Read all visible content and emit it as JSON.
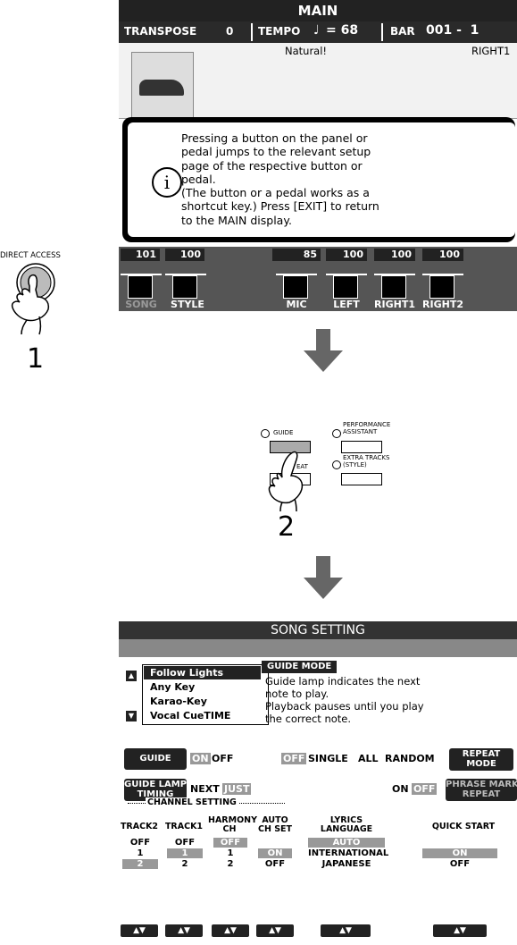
{
  "main_screen": {
    "title": "MAIN",
    "transpose_label": "TRANSPOSE",
    "transpose_value": "0",
    "tempo_label": "TEMPO",
    "tempo_note": "♩",
    "tempo_value": "= 68",
    "bar_label": "BAR",
    "bar_value": "001 -  1",
    "voice_name": "Natural!",
    "voice_part": "RIGHT1",
    "popup_text": "Pressing a button on the panel or\npedal jumps to the relevant setup\npage of the respective button or\npedal.\n(The button or a pedal works as a\nshortcut key.) Press [EXIT] to return\nto the MAIN display.",
    "info_icon": "i",
    "mixer": {
      "values": [
        "101",
        "100",
        "85",
        "100",
        "100",
        "100"
      ],
      "labels": [
        "SONG",
        "STYLE",
        "MIC",
        "LEFT",
        "RIGHT1",
        "RIGHT2"
      ]
    }
  },
  "direct_access": {
    "label": "DIRECT ACCESS",
    "step": "1"
  },
  "panel": {
    "guide_label": "GUIDE",
    "repeat_label": "EAT",
    "performance_label": "PERFORMANCE\nASSISTANT",
    "extra_tracks_label": "EXTRA TRACKS\n(STYLE)",
    "step": "2"
  },
  "song_setting": {
    "title": "SONG SETTING",
    "list": [
      "Follow Lights",
      "Any Key",
      "Karao-Key",
      "Vocal CueTIME"
    ],
    "mode_tag": "GUIDE MODE",
    "description": "Guide lamp indicates the next\nnote to play.\nPlayback pauses until you play\nthe correct note.",
    "guide_lamp_label": "GUIDE LAMP",
    "guide_lamp_on": "ON",
    "guide_lamp_off": "OFF",
    "repeat_off": "OFF",
    "repeat_single": "SINGLE",
    "repeat_all": "ALL",
    "repeat_random": "RANDOM",
    "repeat_mode_label": "REPEAT\nMODE",
    "timing_label": "GUIDE LAMP\nTIMING",
    "timing_next": "NEXT",
    "timing_just": "JUST",
    "phrase_on": "ON",
    "phrase_off": "OFF",
    "phrase_label": "PHRASE MARK\nREPEAT",
    "channel_setting": "CHANNEL SETTING",
    "columns": [
      {
        "label": "TRACK2",
        "values": [
          "OFF",
          "1",
          "2"
        ]
      },
      {
        "label": "TRACK1",
        "values": [
          "OFF",
          "1",
          "2"
        ]
      },
      {
        "label": "HARMONY\nCH",
        "values": [
          "OFF",
          "1",
          "2"
        ]
      },
      {
        "label": "AUTO\nCH SET",
        "values": [
          "ON",
          "OFF"
        ]
      },
      {
        "label": "LYRICS\nLANGUAGE",
        "values": [
          "AUTO",
          "INTERNATIONAL",
          "JAPANESE"
        ]
      },
      {
        "label": "QUICK START",
        "values": [
          "ON",
          "OFF"
        ]
      }
    ],
    "updown": "▲▼"
  }
}
